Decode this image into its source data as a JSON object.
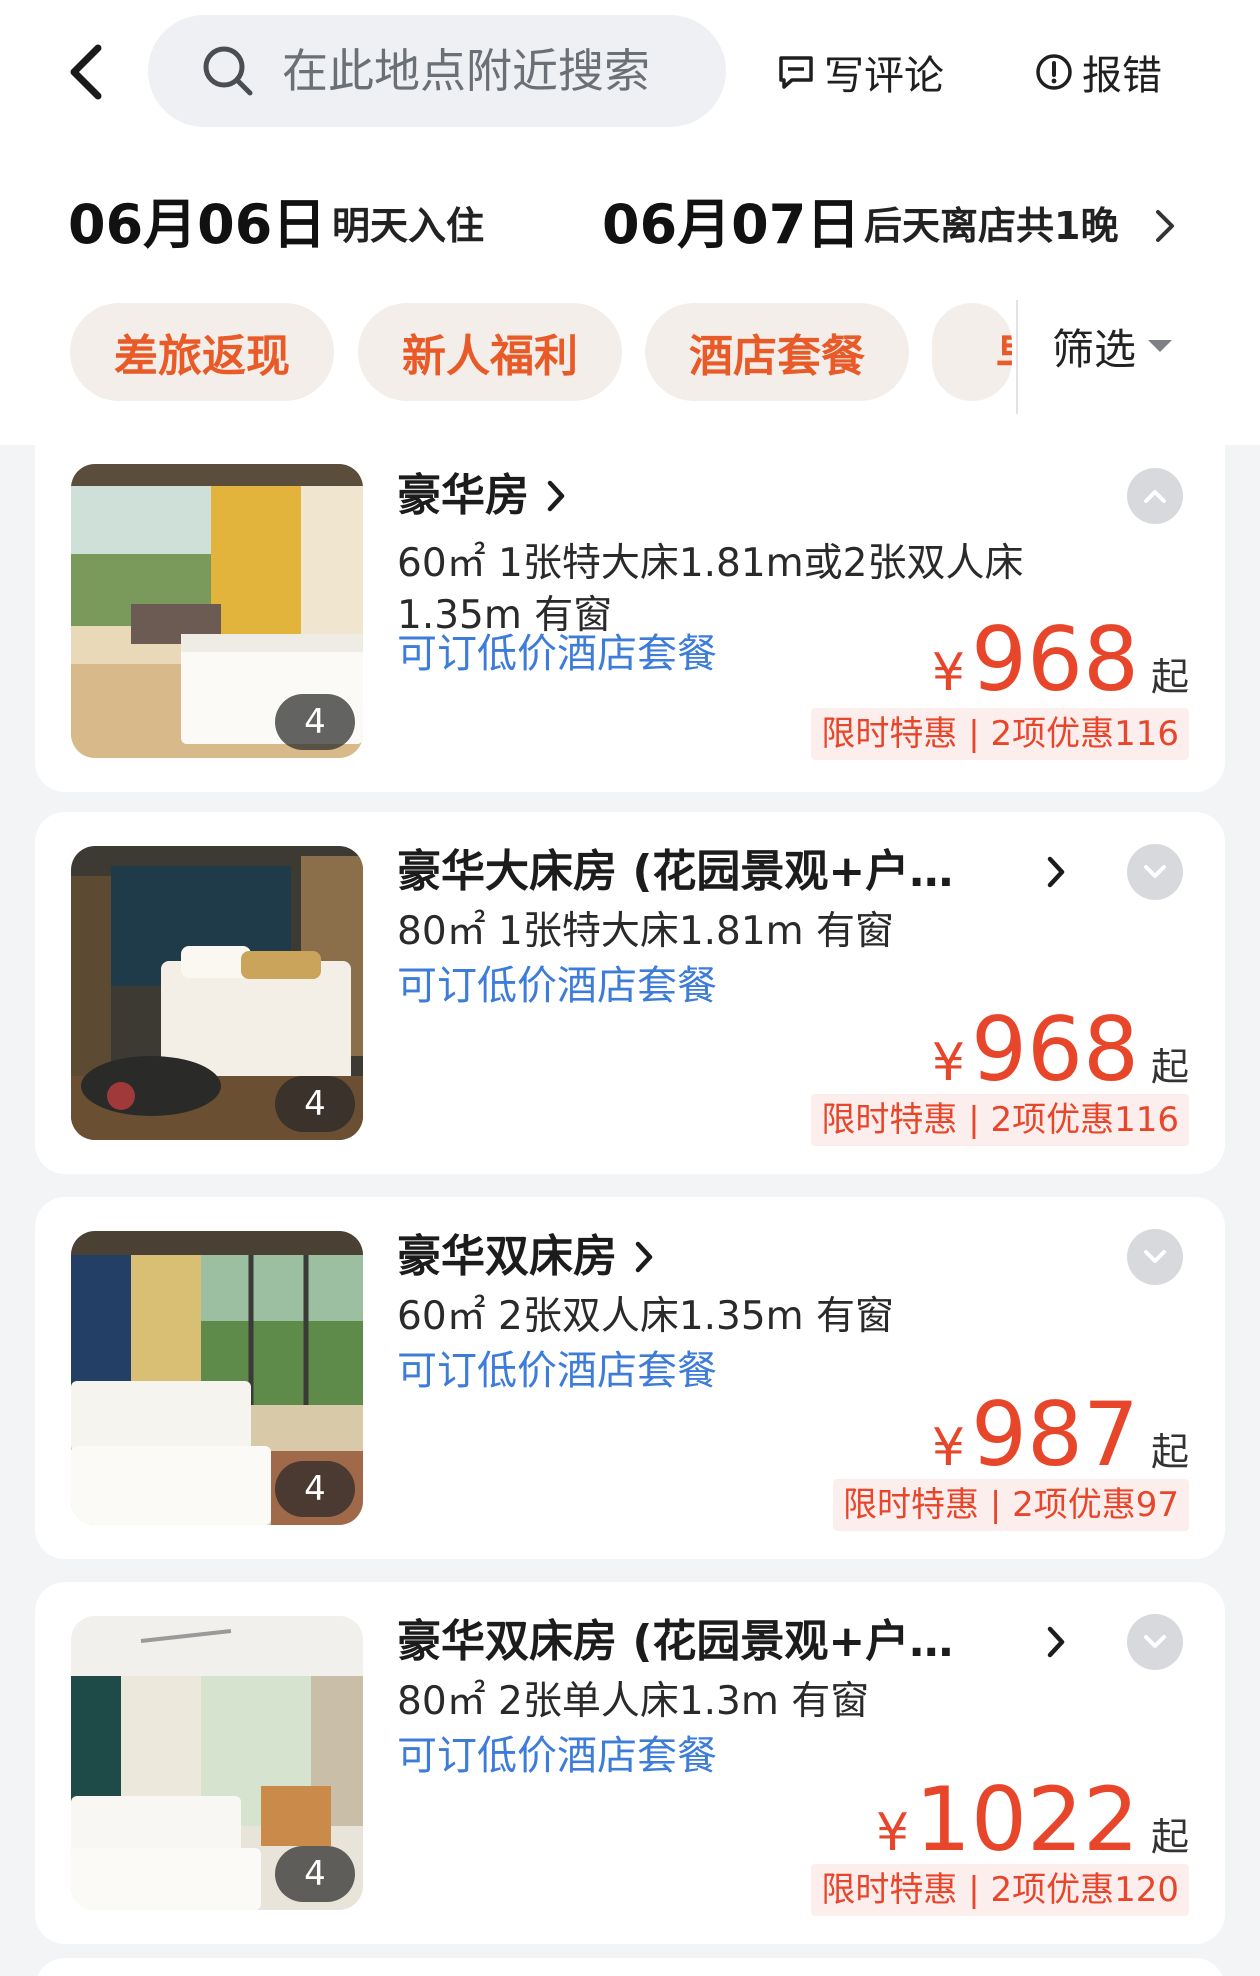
{
  "header": {
    "search_placeholder": "在此地点附近搜索",
    "write_review": "写评论",
    "report_error": "报错"
  },
  "dates": {
    "checkin_date": "06月06日",
    "checkin_label": "明天入住",
    "checkout_date": "06月07日",
    "checkout_label": "后天离店共1晚"
  },
  "filters": {
    "chips": [
      "差旅返现",
      "新人福利",
      "酒店套餐",
      "早"
    ],
    "filter_label": "筛选"
  },
  "colors": {
    "accent_red": "#e8462a",
    "chip_text": "#e85b28",
    "link_blue": "#3d7cd9"
  },
  "rooms": [
    {
      "name": "豪华房",
      "spec": "60㎡ 1张特大床1.81m或2张双人床1.35m 有窗",
      "package": "可订低价酒店套餐",
      "currency": "¥",
      "price": "968",
      "price_suffix": "起",
      "discount": "限时特惠 | 2项优惠116",
      "photo_count": "4",
      "expanded": true
    },
    {
      "name": "豪华大床房 (花园景观+户…",
      "spec": "80㎡ 1张特大床1.81m 有窗",
      "package": "可订低价酒店套餐",
      "currency": "¥",
      "price": "968",
      "price_suffix": "起",
      "discount": "限时特惠 | 2项优惠116",
      "photo_count": "4",
      "expanded": false
    },
    {
      "name": "豪华双床房",
      "spec": "60㎡ 2张双人床1.35m 有窗",
      "package": "可订低价酒店套餐",
      "currency": "¥",
      "price": "987",
      "price_suffix": "起",
      "discount": "限时特惠 | 2项优惠97",
      "photo_count": "4",
      "expanded": false
    },
    {
      "name": "豪华双床房 (花园景观+户…",
      "spec": "80㎡ 2张单人床1.3m 有窗",
      "package": "可订低价酒店套餐",
      "currency": "¥",
      "price": "1022",
      "price_suffix": "起",
      "discount": "限时特惠 | 2项优惠120",
      "photo_count": "4",
      "expanded": false
    }
  ]
}
